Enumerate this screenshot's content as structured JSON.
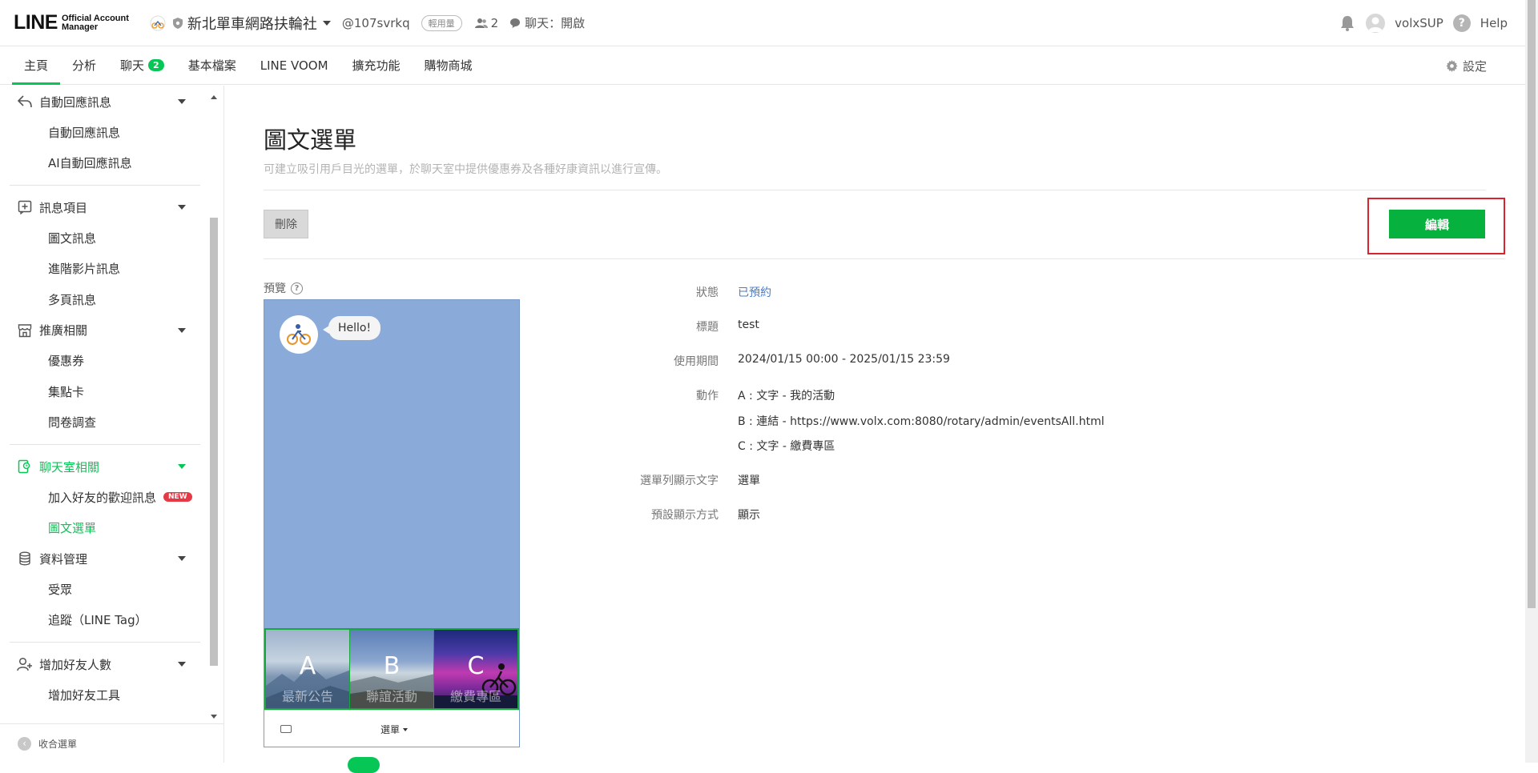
{
  "header": {
    "logo_main": "LINE",
    "logo_sub1": "Official Account",
    "logo_sub2": "Manager",
    "account_name": "新北單車網路扶輪社",
    "account_id": "@107svrkq",
    "plan_badge": "輕用量",
    "friends_count": "2",
    "chat_mode": "聊天：開啟",
    "username": "volxSUP",
    "help_label": "Help"
  },
  "nav": {
    "tabs": [
      {
        "label": "主頁",
        "active": true
      },
      {
        "label": "分析"
      },
      {
        "label": "聊天",
        "badge": "2"
      },
      {
        "label": "基本檔案"
      },
      {
        "label": "LINE VOOM"
      },
      {
        "label": "擴充功能"
      },
      {
        "label": "購物商城"
      }
    ],
    "settings_label": "設定"
  },
  "sidebar": {
    "groups": [
      {
        "label": "自動回應訊息",
        "icon": "reply-icon",
        "items": [
          "自動回應訊息",
          "AI自動回應訊息"
        ]
      },
      {
        "label": "訊息項目",
        "icon": "message-add-icon",
        "items": [
          "圖文訊息",
          "進階影片訊息",
          "多頁訊息"
        ]
      },
      {
        "label": "推廣相關",
        "icon": "store-icon",
        "items": [
          "優惠券",
          "集點卡",
          "問卷調查"
        ]
      },
      {
        "label": "聊天室相關",
        "icon": "chat-room-icon",
        "items": [
          "加入好友的歡迎訊息",
          "圖文選單"
        ]
      },
      {
        "label": "資料管理",
        "icon": "database-icon",
        "items": [
          "受眾",
          "追蹤（LINE Tag）"
        ]
      },
      {
        "label": "增加好友人數",
        "icon": "add-friend-icon",
        "items": [
          "增加好友工具"
        ]
      }
    ],
    "new_badge": "NEW",
    "collapse_label": "收合選單"
  },
  "main": {
    "title": "圖文選單",
    "description": "可建立吸引用戶目光的選單，於聊天室中提供優惠券及各種好康資訊以進行宣傳。",
    "delete_label": "刪除",
    "edit_label": "編輯",
    "preview_label": "預覽",
    "preview": {
      "bubble": "Hello!",
      "menu_cells": [
        {
          "letter": "A",
          "text": "最新公告"
        },
        {
          "letter": "B",
          "text": "聯誼活動"
        },
        {
          "letter": "C",
          "text": "繳費專區"
        }
      ],
      "menu_toggle": "選單"
    },
    "details": {
      "status_label": "狀態",
      "status_value": "已預約",
      "title_label": "標題",
      "title_value": "test",
      "period_label": "使用期間",
      "period_value": "2024/01/15 00:00 - 2025/01/15 23:59",
      "action_label": "動作",
      "actions": [
        "A : 文字 - 我的活動",
        "B : 連結 - https://www.volx.com:8080/rotary/admin/eventsAll.html",
        "C : 文字 - 繳費專區"
      ],
      "menubar_label": "選單列顯示文字",
      "menubar_value": "選單",
      "default_label": "預設顯示方式",
      "default_value": "顯示"
    }
  },
  "colors": {
    "accent": "#06c755",
    "edit_button": "#06b13d",
    "highlight": "#d9232e",
    "link": "#4a7dc9",
    "preview_bg": "#8aaada"
  }
}
